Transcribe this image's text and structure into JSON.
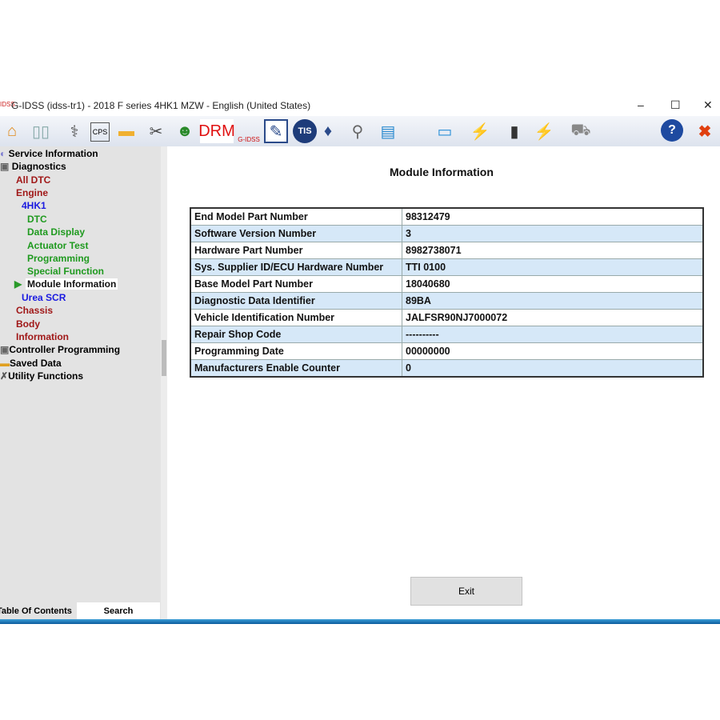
{
  "window": {
    "app_logo": "IDSS",
    "title": "G-IDSS (idss-tr1) - 2018 F series 4HK1 MZW - English (United States)",
    "minimize": "–",
    "maximize": "☐",
    "close": "✕"
  },
  "toolbar": {
    "drm_label": "DRM",
    "tis_label": "TIS",
    "gidss_label": "G-IDSS",
    "cps_label": "CPS"
  },
  "sidebar": {
    "items": [
      {
        "label": "Service Information",
        "color": "#111111"
      },
      {
        "label": "Diagnostics",
        "color": "#111111"
      },
      {
        "label": "All DTC",
        "color": "#a01818"
      },
      {
        "label": "Engine",
        "color": "#a01818"
      },
      {
        "label": "4HK1",
        "color": "#1a1ae0"
      },
      {
        "label": "DTC",
        "color": "#1f9a1f"
      },
      {
        "label": "Data Display",
        "color": "#1f9a1f"
      },
      {
        "label": "Actuator Test",
        "color": "#1f9a1f"
      },
      {
        "label": "Programming",
        "color": "#1f9a1f"
      },
      {
        "label": "Special Function",
        "color": "#1f9a1f"
      },
      {
        "label": "Module Information",
        "color": "#111111"
      },
      {
        "label": "Urea SCR",
        "color": "#1a1ae0"
      },
      {
        "label": "Chassis",
        "color": "#a01818"
      },
      {
        "label": "Body",
        "color": "#a01818"
      },
      {
        "label": "Information",
        "color": "#a01818"
      },
      {
        "label": "Controller Programming",
        "color": "#111111"
      },
      {
        "label": "Saved Data",
        "color": "#111111"
      },
      {
        "label": "Utility Functions",
        "color": "#111111"
      }
    ],
    "tabs": [
      "Table Of Contents",
      "Search"
    ]
  },
  "main": {
    "heading": "Module Information",
    "rows": [
      [
        "End Model Part Number",
        "98312479"
      ],
      [
        "Software Version Number",
        "3"
      ],
      [
        "Hardware Part Number",
        "8982738071"
      ],
      [
        "Sys. Supplier ID/ECU Hardware Number",
        "TTI  0100"
      ],
      [
        "Base Model Part Number",
        "18040680"
      ],
      [
        "Diagnostic Data Identifier",
        "89BA"
      ],
      [
        "Vehicle Identification Number",
        "JALFSR90NJ7000072"
      ],
      [
        "Repair Shop Code",
        "----------"
      ],
      [
        "Programming Date",
        "00000000"
      ],
      [
        "Manufacturers Enable Counter",
        "0"
      ]
    ],
    "exit_label": "Exit"
  }
}
